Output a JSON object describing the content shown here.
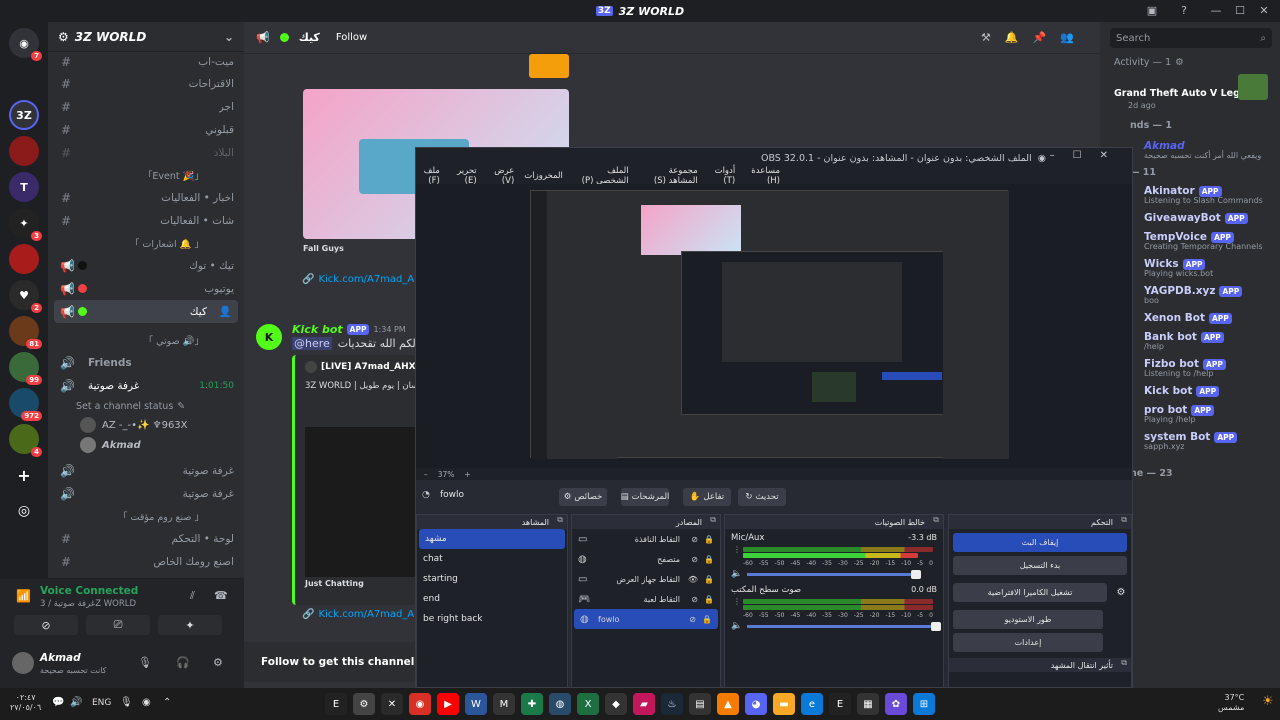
{
  "window": {
    "title": "3Z WORLD"
  },
  "rail": {
    "servers": [
      {
        "label": "",
        "badge": "7"
      },
      {
        "label": "",
        "badge": ""
      },
      {
        "label": "3Z",
        "badge": ""
      },
      {
        "label": "",
        "badge": ""
      },
      {
        "label": "T",
        "badge": ""
      },
      {
        "label": "",
        "badge": "3"
      },
      {
        "label": "",
        "badge": ""
      },
      {
        "label": "",
        "badge": "2"
      },
      {
        "label": "",
        "badge": "81"
      },
      {
        "label": "",
        "badge": "99"
      },
      {
        "label": "",
        "badge": "972"
      },
      {
        "label": "",
        "badge": "4"
      }
    ]
  },
  "server": {
    "name": "3Z WORLD"
  },
  "channels": {
    "top": [
      {
        "name": "ميت-اب"
      },
      {
        "name": "الاقتراحات"
      },
      {
        "name": "اجر"
      },
      {
        "name": "قبلوني"
      },
      {
        "name": "البلاد"
      }
    ],
    "event_category": "「Event 🎉」",
    "event": [
      {
        "name": "اخبار • الفعاليات"
      },
      {
        "name": "شات • الفعاليات"
      }
    ],
    "streams_category": "「 اشعارات 🔔 」",
    "streams": [
      {
        "name": "تيك • توك"
      },
      {
        "name": "يوتيوب"
      },
      {
        "name": "كيك"
      }
    ],
    "voice_category": "「 صوتي 🔊」",
    "voice": [
      {
        "name": "Friends"
      },
      {
        "name": "غرفة صوتية",
        "time": "1:01:50"
      }
    ],
    "set_status": "Set a channel status",
    "voice_users": [
      {
        "name": "AZ -_-•✨ ♆963X"
      },
      {
        "name": "Akmad"
      }
    ],
    "voice_more": [
      {
        "name": "غرفة صوتية"
      },
      {
        "name": "غرفة صوتية"
      }
    ],
    "create_category": "「 صنع روم مؤقت 」",
    "create": [
      {
        "name": "لوحة • التحكم"
      },
      {
        "name": "اصنع رومك الخاص"
      }
    ]
  },
  "voice_connected": {
    "title": "Voice Connected",
    "subtitle": "غرفة صوتية / 3Z WORLD"
  },
  "user": {
    "name": "Akmad",
    "status": "كانت تحسبه صحيحة"
  },
  "chat": {
    "header": {
      "channel": "كيك",
      "follow": "Follow"
    },
    "msg1": {
      "game": "Fall Guys",
      "link": "Kick.com/A7mad_AHX1"
    },
    "msg2": {
      "author": "Kick bot",
      "app": "APP",
      "time": "1:34 PM",
      "mention": "@here",
      "text": "حيالكم الله تقحديات",
      "embed_title": "[LIVE] A7mad_AHX1",
      "embed_sub": "3Z WORLD | الحسان | يوم طويل",
      "game": "Just Chatting",
      "link": "Kick.com/A7mad_AHX1"
    },
    "follow_cta": "Follow to get this channel's updates"
  },
  "search": {
    "placeholder": "Search"
  },
  "members": {
    "activity_header": "Activity — 1",
    "activity_game": "Grand Theft Auto V Legacy",
    "activity_time": "2d ago",
    "friends_header": "nds — 1",
    "friend": {
      "name": "Akmad",
      "status": "ويفعي الله أمر أكنت تحسبه صحيحة"
    },
    "bots_header": "— 11",
    "bots": [
      {
        "name": "Akinator",
        "status": "Listening to Slash Commands"
      },
      {
        "name": "GiveawayBot",
        "status": ""
      },
      {
        "name": "TempVoice",
        "status": "Creating Temporary Channels"
      },
      {
        "name": "Wicks",
        "status": "Playing wicks.bot"
      },
      {
        "name": "YAGPDB.xyz",
        "status": "boo"
      },
      {
        "name": "Xenon Bot",
        "status": ""
      },
      {
        "name": "Bank bot",
        "status": "/help"
      },
      {
        "name": "Fizbo bot",
        "status": "Listening to /help"
      },
      {
        "name": "Kick bot",
        "status": ""
      },
      {
        "name": "pro bot",
        "status": "Playing /help"
      },
      {
        "name": "system Bot",
        "status": "sapph.xyz"
      }
    ],
    "app_tag": "APP",
    "online_header": "ne — 23"
  },
  "obs": {
    "title": "OBS 32.0.1 - الملف الشخصي: بدون عنوان - المشاهد: بدون عنوان",
    "menu": [
      "ملف (F)",
      "تحرير (E)",
      "عرض (V)",
      "المخروزات",
      "الملف الشخصي (P)",
      "مجموعة المشاهد (S)",
      "أدوات (T)",
      "مساعدة (H)"
    ],
    "zoom": "37%",
    "toolbar": {
      "selected": "fowlo",
      "props": "خصائص",
      "filters": "المرشحات",
      "interact": "تفاعل",
      "refresh": "تحديث"
    },
    "scenes_title": "المشاهد",
    "scenes": [
      "مشهد",
      "chat",
      "starting",
      "end",
      "be right back"
    ],
    "sources_title": "المصادر",
    "sources": [
      "التقاط النافذة",
      "متصفح",
      "التقاط جهاز العرض",
      "التقاط لعبة",
      "fowlo"
    ],
    "mixer_title": "خالط الصوتيات",
    "mixer": [
      {
        "name": "Mic/Aux",
        "db": "-3.3 dB"
      },
      {
        "name": "صوت سطح المكتب",
        "db": "0.0 dB"
      }
    ],
    "scale": [
      "-60",
      "-55",
      "-50",
      "-45",
      "-40",
      "-35",
      "-30",
      "-25",
      "-20",
      "-15",
      "-10",
      "-5",
      "0"
    ],
    "controls_title": "التحكم",
    "controls": [
      "إيقاف البث",
      "بدء التسجيل",
      "تشغيل الكاميرا الافتراضية",
      "طور الاستوديو",
      "إعدادات"
    ],
    "transition_title": "تأثير انتقال المشهد"
  },
  "taskbar": {
    "lang": "ENG",
    "time": "٠٢:٤٧",
    "date": "٢٧/٠٥/٠٦",
    "weather": "37°C",
    "weather_desc": "مشمس"
  },
  "colors": {
    "accent": "#5865f2",
    "kick": "#53fc18",
    "online": "#23a55a",
    "obs_select": "#284cb8"
  }
}
